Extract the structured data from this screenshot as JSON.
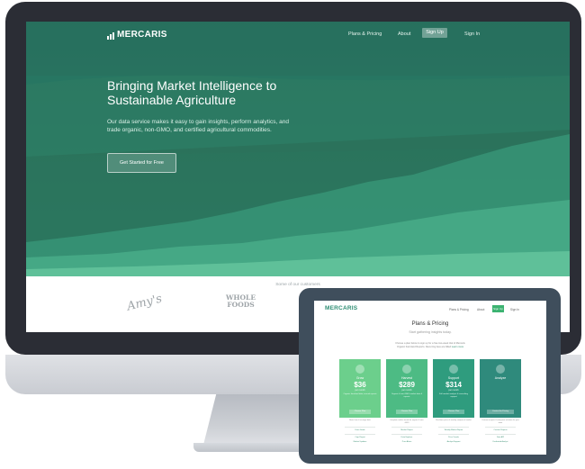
{
  "desktop": {
    "nav": {
      "logo": "MERCARIS",
      "plans": "Plans & Pricing",
      "about": "About",
      "signup": "Sign Up",
      "signin": "Sign In"
    },
    "hero": {
      "title_line1": "Bringing Market Intelligence to",
      "title_line2": "Sustainable Agriculture",
      "sub_line1": "Our data service makes it easy to gain insights, perform analytics, and",
      "sub_line2": "trade organic, non-GMO, and certified agricultural commodities.",
      "cta": "Get Started for Free"
    },
    "customers": {
      "label": "Some of our customers",
      "amys": "Amy's",
      "wf1": "WHOLE",
      "wf2": "FOODS"
    }
  },
  "tablet": {
    "nav": {
      "logo": "MERCARIS",
      "plans": "Plans & Pricing",
      "about": "About",
      "signup": "Sign Up",
      "signin": "Sign In"
    },
    "title": "Plans & Pricing",
    "subtitle": "Start gathering insights today.",
    "desc_line1": "Choose a plan below to sign up for a free two-week trial of Mercaris",
    "desc_line2": "Organic Farmland Reports. Recurring fees are billed",
    "desc_link": "Learn more",
    "plans": [
      {
        "name": "Grow",
        "price": "$36",
        "per": "per month",
        "features": "Organic farmland data, annual reports",
        "button": "Choose Plan",
        "desc": "Basic farm & acreage data",
        "links": [
          "Farm Guide",
          "Crop Report",
          "Market Updates"
        ]
      },
      {
        "name": "Harvest",
        "price": "$289",
        "per": "per month",
        "features": "Organic & non-GMO market data & reports",
        "button": "Choose Plan",
        "desc": "Complete market trends for organic & non-GMO",
        "links": [
          "Market Report",
          "Data Explorer",
          "Price Alerts"
        ]
      },
      {
        "name": "Support",
        "price": "$314",
        "per": "per month",
        "features": "Full market analysis & consulting support",
        "button": "Choose Plan",
        "desc": "Real-time prices & weekly analysis of market",
        "links": [
          "Weekly Market Report",
          "Price Trends",
          "Analyst Support"
        ]
      },
      {
        "name": "Analyze",
        "price": "",
        "per": "",
        "features": "",
        "button": "Contact for Pricing",
        "desc": "Custom analysis & enterprise solutions for your team",
        "links": [
          "Custom Reports",
          "Data API",
          "Dedicated Analyst"
        ]
      }
    ],
    "colors": [
      "#6ccf8c",
      "#4dbb84",
      "#2f9c7e",
      "#2f8a7c"
    ]
  }
}
